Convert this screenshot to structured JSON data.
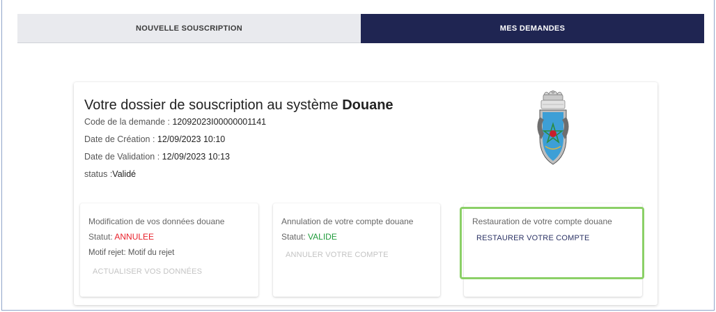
{
  "tabs": {
    "new_subscription": "NOUVELLE SOUSCRIPTION",
    "my_requests": "MES DEMANDES",
    "active_color": "#1f2552"
  },
  "dossier": {
    "title_prefix": "Votre dossier de souscription au système",
    "title_bold": "Douane",
    "code_label": "Code de la demande : ",
    "code_value": "12092023I00000001141",
    "creation_label": "Date de Création : ",
    "creation_value": "12/09/2023 10:10",
    "validation_label": "Date de Validation : ",
    "validation_value": "12/09/2023 10:13",
    "status_label": "status :",
    "status_value": "Validé"
  },
  "emblem": {
    "icon": "customs-emblem-icon"
  },
  "cards": {
    "modification": {
      "title": "Modification de vos données douane",
      "status_label": "Statut: ",
      "status_value": "ANNULEE",
      "status_color": "#e8202a",
      "reason_label": "Motif rejet: ",
      "reason_value": "Motif du rejet",
      "action": "ACTUALISER VOS DONNÉES"
    },
    "cancellation": {
      "title": "Annulation de votre compte douane",
      "status_label": "Statut: ",
      "status_value": "VALIDE",
      "status_color": "#1f9b3a",
      "action": "ANNULER VOTRE COMPTE"
    },
    "restoration": {
      "title": "Restauration de votre compte douane",
      "action": "RESTAURER VOTRE COMPTE",
      "highlight_color": "#8bd067"
    }
  }
}
